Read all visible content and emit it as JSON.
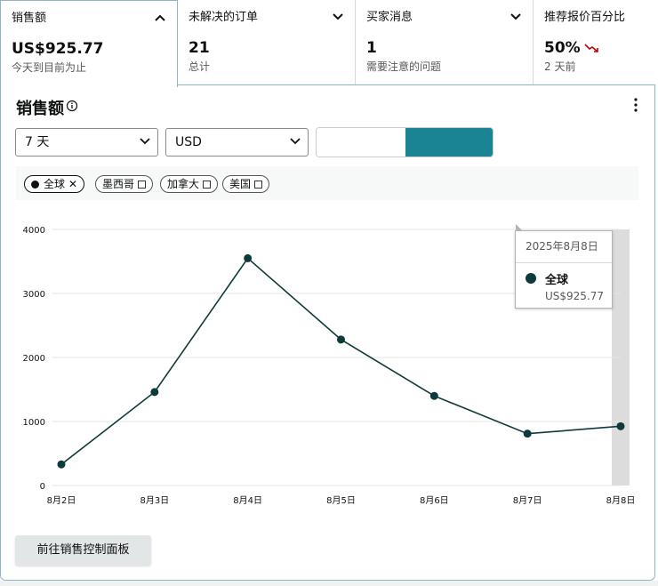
{
  "cards": [
    {
      "label": "销售额",
      "value": "US$925.77",
      "sub": "今天到目前为止",
      "expanded": true
    },
    {
      "label": "未解决的订单",
      "value": "21",
      "sub": "总计",
      "expanded": false
    },
    {
      "label": "买家消息",
      "value": "1",
      "sub": "需要注意的问题",
      "expanded": false
    },
    {
      "label": "推荐报价百分比",
      "value": "50%",
      "sub": "2 天前",
      "trend": "down"
    }
  ],
  "panel": {
    "title": "销售额",
    "period_select": "7 天",
    "currency_select": "USD",
    "toggle_active": "right",
    "filters": [
      {
        "label": "全球",
        "selected": true
      },
      {
        "label": "墨西哥",
        "selected": false
      },
      {
        "label": "加拿大",
        "selected": false
      },
      {
        "label": "美国",
        "selected": false
      }
    ],
    "goto_button": "前往销售控制面板"
  },
  "tooltip": {
    "date": "2025年8月8日",
    "series": "全球",
    "value": "US$925.77"
  },
  "colors": {
    "accent": "#1a8394",
    "line": "#0d3a3a",
    "trend_down": "#c40000"
  },
  "chart_data": {
    "type": "line",
    "categories": [
      "8月2日",
      "8月3日",
      "8月4日",
      "8月5日",
      "8月6日",
      "8月7日",
      "8月8日"
    ],
    "series": [
      {
        "name": "全球",
        "values": [
          330,
          1460,
          3550,
          2280,
          1400,
          810,
          925.77
        ]
      }
    ],
    "y_ticks": [
      0,
      1000,
      2000,
      3000,
      4000
    ],
    "ylim": [
      0,
      4000
    ],
    "grid": true,
    "highlight_category": "8月8日"
  }
}
